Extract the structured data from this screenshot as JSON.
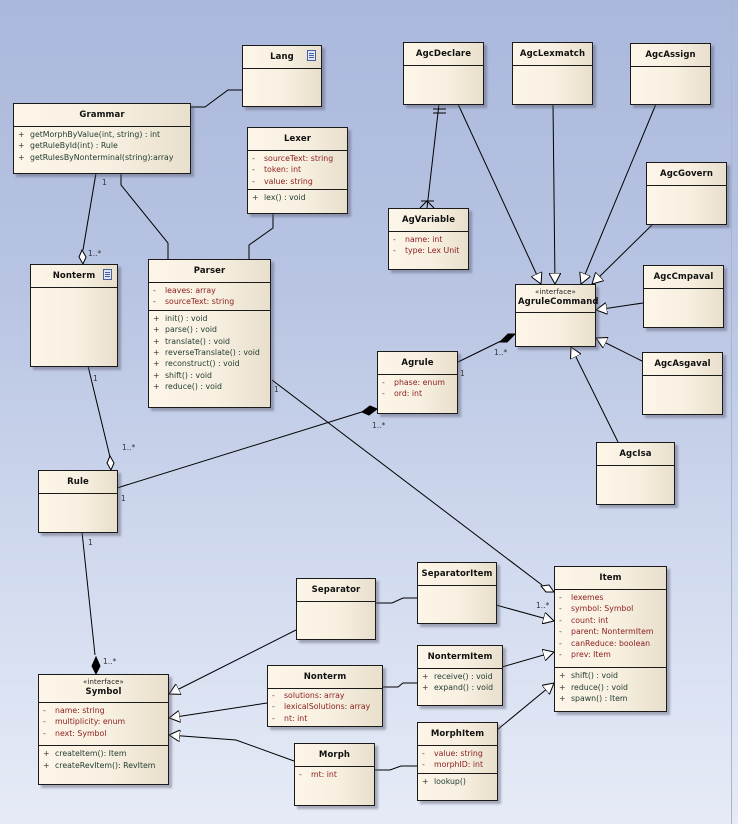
{
  "diagram": {
    "type": "UML class diagram",
    "classes": {
      "lang": {
        "name": "Lang",
        "icon": "table-icon",
        "attributes": [],
        "operations": []
      },
      "grammar": {
        "name": "Grammar",
        "attributes": [],
        "operations": [
          {
            "vis": "+",
            "text": "getMorphByValue(int, string) : int"
          },
          {
            "vis": "+",
            "text": "getRuleById(int) : Rule"
          },
          {
            "vis": "+",
            "text": "getRulesByNonterminal(string):array"
          }
        ]
      },
      "lexer": {
        "name": "Lexer",
        "attributes": [
          {
            "vis": "-",
            "text": "sourceText: string"
          },
          {
            "vis": "-",
            "text": "token:  int"
          },
          {
            "vis": "-",
            "text": "value:  string"
          }
        ],
        "operations": [
          {
            "vis": "+",
            "text": "lex() : void"
          }
        ]
      },
      "agc_declare": {
        "name": "AgcDeclare"
      },
      "agc_lexmatch": {
        "name": "AgcLexmatch"
      },
      "agc_assign": {
        "name": "AgcAssign"
      },
      "ag_variable": {
        "name": "AgVariable",
        "attributes": [
          {
            "vis": "-",
            "text": "name:  int"
          },
          {
            "vis": "-",
            "text": "type:  Lex Unit"
          }
        ]
      },
      "agc_govern": {
        "name": "AgcGovern"
      },
      "nonterm_top": {
        "name": "Nonterm",
        "icon": "table-icon"
      },
      "parser": {
        "name": "Parser",
        "attributes": [
          {
            "vis": "-",
            "text": "leaves: array"
          },
          {
            "vis": "-",
            "text": "sourceText: string"
          }
        ],
        "operations": [
          {
            "vis": "+",
            "text": "init() : void"
          },
          {
            "vis": "+",
            "text": "parse() : void"
          },
          {
            "vis": "+",
            "text": "translate() : void"
          },
          {
            "vis": "+",
            "text": "reverseTranslate() : void"
          },
          {
            "vis": "+",
            "text": "reconstruct() : void"
          },
          {
            "vis": "+",
            "text": "shift() : void"
          },
          {
            "vis": "+",
            "text": "reduce() : void"
          }
        ]
      },
      "agc_cmpaval": {
        "name": "AgcCmpaval"
      },
      "agrule_command": {
        "name": "AgruleCommand",
        "stereotype": "«interface»"
      },
      "agrule": {
        "name": "Agrule",
        "attributes": [
          {
            "vis": "-",
            "text": "phase:  enum"
          },
          {
            "vis": "-",
            "text": "ord:  int"
          }
        ]
      },
      "agc_asgaval": {
        "name": "AgcAsgaval"
      },
      "agc_isa": {
        "name": "AgcIsa"
      },
      "rule": {
        "name": "Rule"
      },
      "separator": {
        "name": "Separator"
      },
      "separator_item": {
        "name": "SeparatorItem"
      },
      "item": {
        "name": "Item",
        "attributes": [
          {
            "vis": "-",
            "text": "lexemes"
          },
          {
            "vis": "-",
            "text": "symbol: Symbol"
          },
          {
            "vis": "-",
            "text": "count:  int"
          },
          {
            "vis": "-",
            "text": "parent:  NontermItem"
          },
          {
            "vis": "-",
            "text": "canReduce:  boolean"
          },
          {
            "vis": "-",
            "text": "prev:  Item"
          }
        ],
        "operations": [
          {
            "vis": "+",
            "text": "shift() : void"
          },
          {
            "vis": "+",
            "text": "reduce() : void"
          },
          {
            "vis": "+",
            "text": "spawn() : Item"
          }
        ]
      },
      "nonterm_item": {
        "name": "NontermItem",
        "operations": [
          {
            "vis": "+",
            "text": "receive() : void"
          },
          {
            "vis": "+",
            "text": "expand() : void"
          }
        ]
      },
      "nonterm_bottom": {
        "name": "Nonterm",
        "attributes": [
          {
            "vis": "-",
            "text": "solutions: array"
          },
          {
            "vis": "-",
            "text": "lexicalSolutions: array"
          },
          {
            "vis": "-",
            "text": "nt:  int"
          }
        ]
      },
      "morph_item": {
        "name": "MorphItem",
        "attributes": [
          {
            "vis": "-",
            "text": "value:  string"
          },
          {
            "vis": "-",
            "text": "morphID:  int"
          }
        ],
        "operations": [
          {
            "vis": "+",
            "text": "lookup()"
          }
        ]
      },
      "symbol": {
        "name": "Symbol",
        "stereotype": "«interface»",
        "attributes": [
          {
            "vis": "-",
            "text": "name:  string"
          },
          {
            "vis": "-",
            "text": "multiplicity:  enum"
          },
          {
            "vis": "-",
            "text": "next:  Symbol"
          }
        ],
        "operations": [
          {
            "vis": "+",
            "text": "createItem(): Item"
          },
          {
            "vis": "+",
            "text": "createRevItem(): RevItem"
          }
        ]
      },
      "morph": {
        "name": "Morph",
        "attributes": [
          {
            "vis": "-",
            "text": "mt:  int"
          }
        ]
      }
    },
    "multiplicities": {
      "grammar_nonterm_src": "1",
      "grammar_nonterm_dst": "1..*",
      "nonterm_rule_src": "1",
      "nonterm_rule_dst": "1..*",
      "rule_agrule_src": "1",
      "rule_agrule_dst": "1..*",
      "agrule_cmd_src": "1",
      "agrule_cmd_dst": "1..*",
      "rule_symbol_src": "1",
      "rule_symbol_dst": "1..*",
      "parser_item_src": "1",
      "parser_item_dst": "1..*"
    },
    "colors": {
      "attribute_text": "#8a1c1c",
      "operation_text": "#1d3a2e",
      "class_fill": "#f7efe0",
      "background": "#b8c4e2"
    }
  }
}
